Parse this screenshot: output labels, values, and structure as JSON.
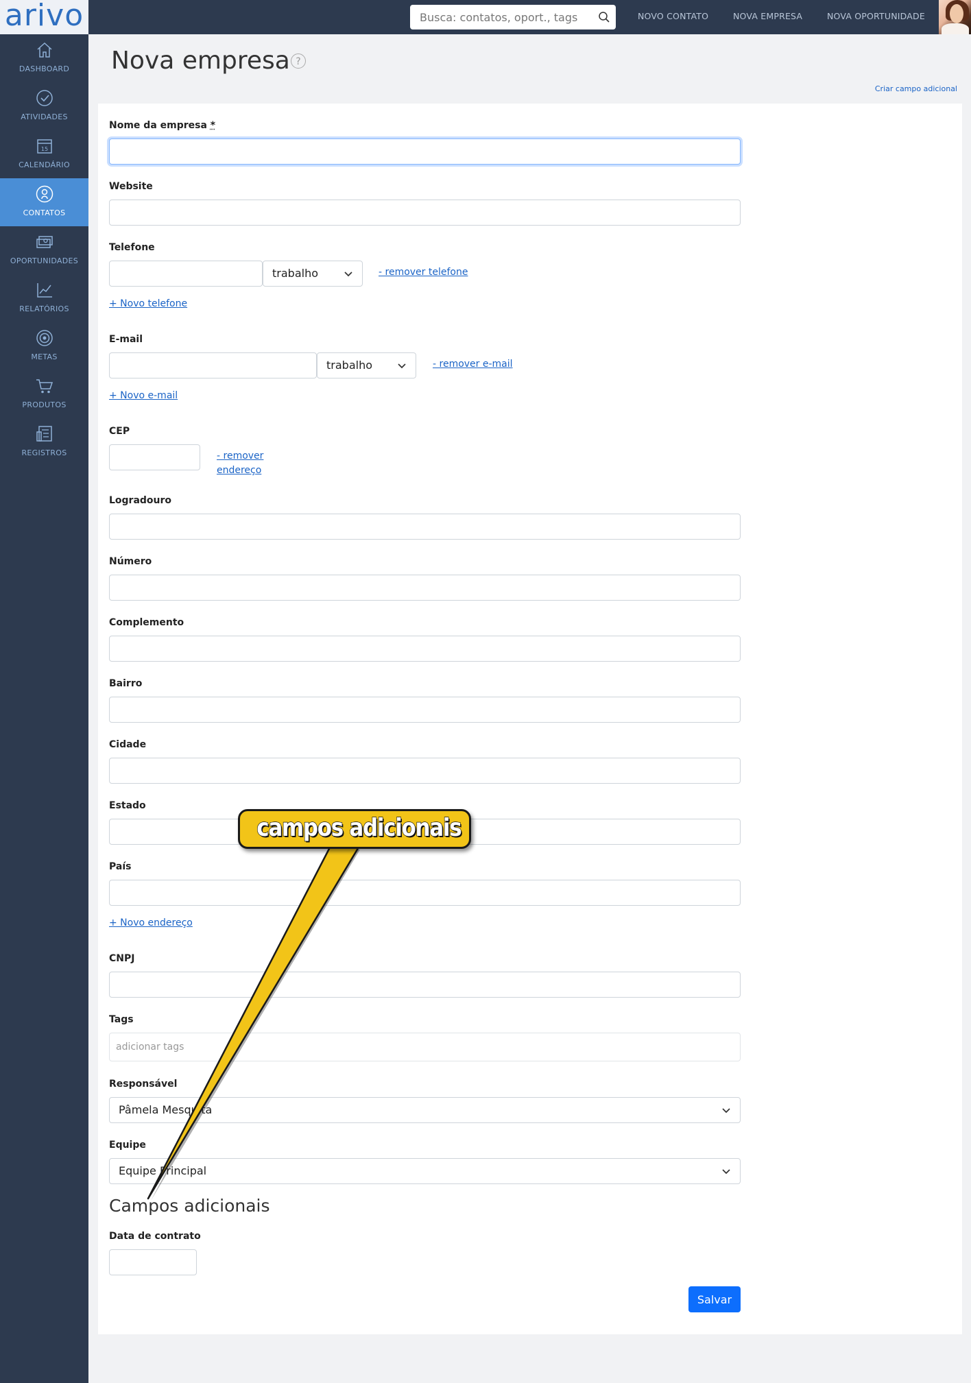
{
  "app": {
    "logo_text": "arivo"
  },
  "topbar": {
    "search_placeholder": "Busca: contatos, oport., tags",
    "nav": [
      "NOVO CONTATO",
      "NOVA EMPRESA",
      "NOVA OPORTUNIDADE"
    ]
  },
  "sidebar": {
    "active": "CONTATOS",
    "items": [
      {
        "label": "DASHBOARD",
        "icon": "home-icon"
      },
      {
        "label": "ATIVIDADES",
        "icon": "check-circle-icon"
      },
      {
        "label": "CALENDÁRIO",
        "icon": "calendar-icon",
        "icon_text": "15"
      },
      {
        "label": "CONTATOS",
        "icon": "contacts-icon"
      },
      {
        "label": "OPORTUNIDADES",
        "icon": "money-icon"
      },
      {
        "label": "RELATÓRIOS",
        "icon": "chart-icon"
      },
      {
        "label": "METAS",
        "icon": "target-icon"
      },
      {
        "label": "PRODUTOS",
        "icon": "cart-icon"
      },
      {
        "label": "REGISTROS",
        "icon": "records-icon"
      }
    ]
  },
  "header": {
    "title": "Nova empresa",
    "help": "?",
    "create_field_link": "Criar campo adicional"
  },
  "form": {
    "company_name_label": "Nome da empresa",
    "required_mark": "*",
    "website_label": "Website",
    "phone_label": "Telefone",
    "phone_type": "trabalho",
    "remove_phone": "- remover telefone",
    "add_phone": "+ Novo telefone",
    "email_label": "E-mail",
    "email_type": "trabalho",
    "remove_email": "- remover e-mail",
    "add_email": "+ Novo e-mail",
    "cep_label": "CEP",
    "remove_address_1": "- remover",
    "remove_address_2": "endereço",
    "street_label": "Logradouro",
    "number_label": "Número",
    "complement_label": "Complemento",
    "district_label": "Bairro",
    "city_label": "Cidade",
    "state_label": "Estado",
    "country_label": "País",
    "add_address": "+ Novo endereço",
    "cnpj_label": "CNPJ",
    "tags_label": "Tags",
    "tags_placeholder": "adicionar tags",
    "owner_label": "Responsável",
    "owner_value": "Pâmela Mesquita",
    "team_label": "Equipe",
    "team_value": "Equipe Principal",
    "additional_section_title": "Campos adicionais",
    "contract_date_label": "Data de contrato",
    "save_button": "Salvar"
  },
  "annotation": {
    "callout_text": "campos adicionais",
    "fill_color": "#f2c418"
  },
  "colors": {
    "sidebar_bg": "#2d3a4f",
    "sidebar_active": "#4a8ed6",
    "link": "#1a63c6",
    "primary_button": "#0d6efd"
  }
}
